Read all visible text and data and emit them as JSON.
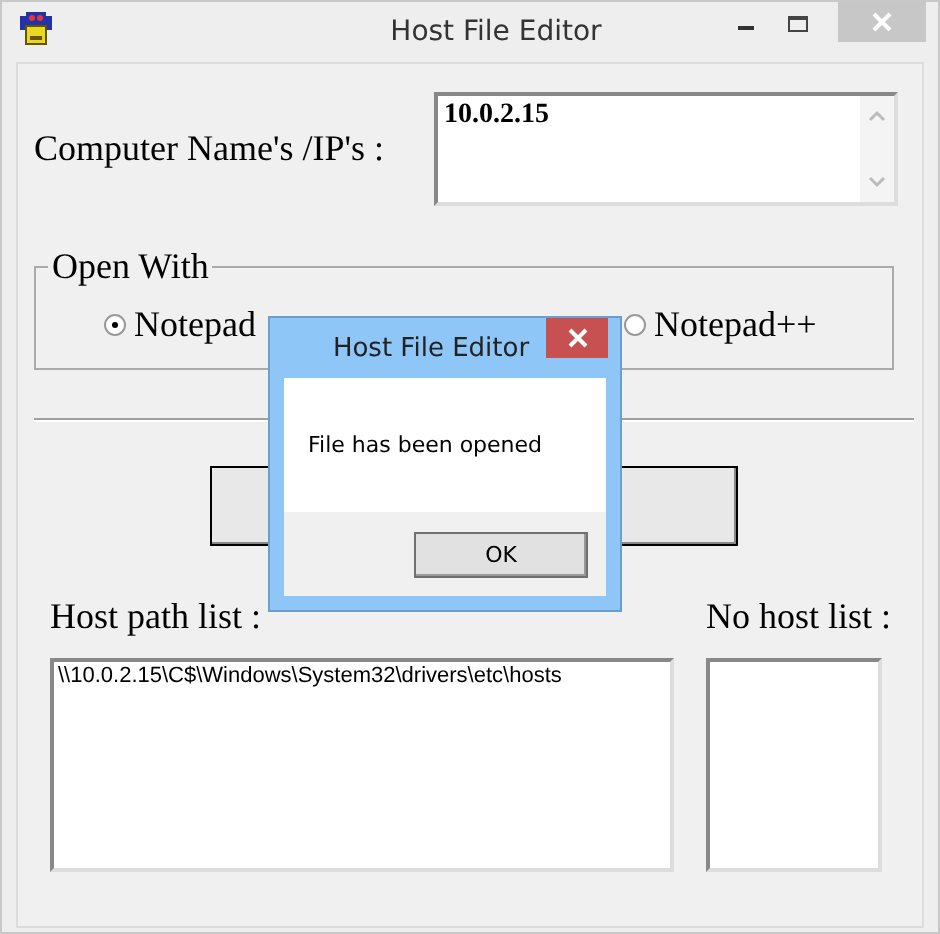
{
  "window": {
    "title": "Host File Editor"
  },
  "computer_field": {
    "label": "Computer Name's /IP's :",
    "value": "10.0.2.15"
  },
  "open_with": {
    "title": "Open With",
    "options": [
      {
        "label": "Notepad",
        "selected": true
      },
      {
        "label": "Notepad++",
        "selected": false
      }
    ]
  },
  "host_path_list": {
    "label": "Host path list :",
    "items": [
      "\\\\10.0.2.15\\C$\\Windows\\System32\\drivers\\etc\\hosts"
    ]
  },
  "no_host_list": {
    "label": "No host list :"
  },
  "dialog": {
    "title": "Host File Editor",
    "message": "File has been opened",
    "buttons": [
      "OK"
    ]
  }
}
